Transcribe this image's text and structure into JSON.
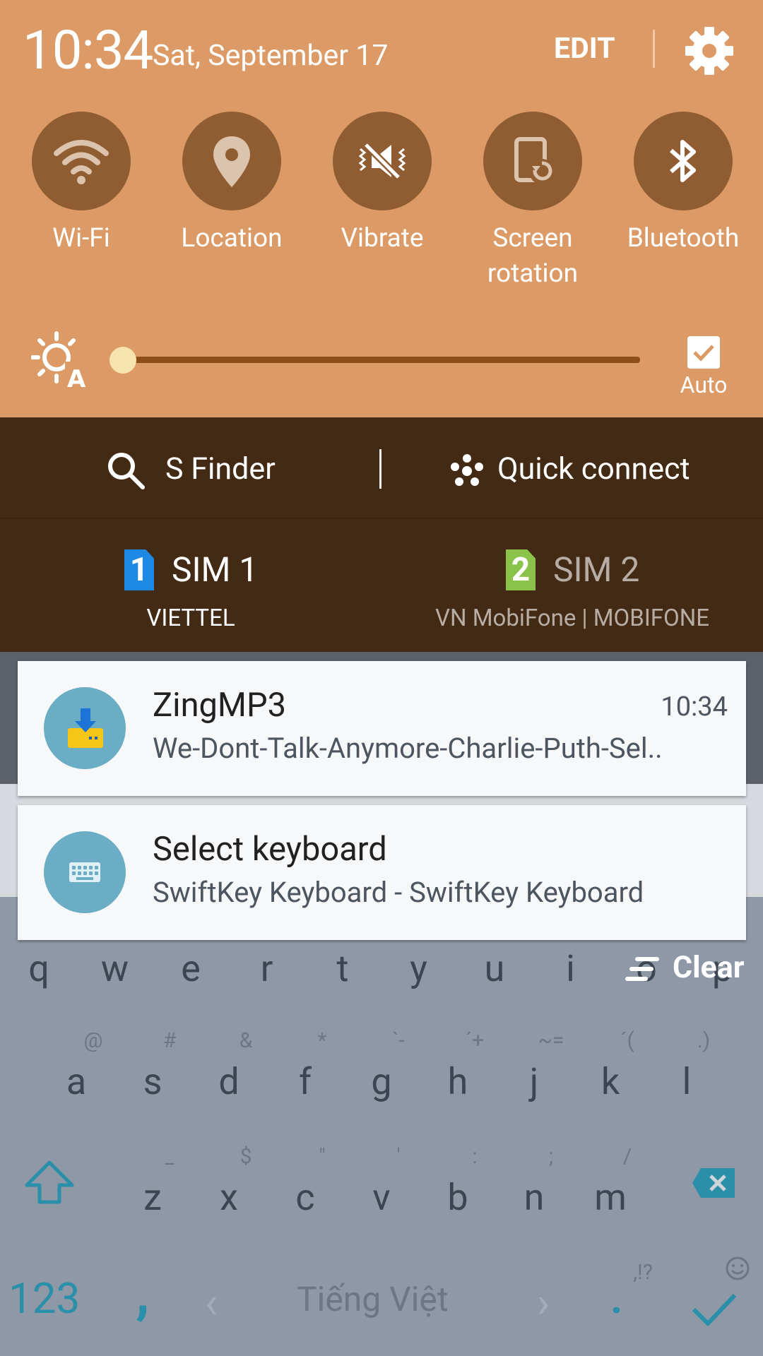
{
  "status": {
    "time": "10:34",
    "date": "Sat, September 17",
    "edit_label": "EDIT"
  },
  "quick_toggles": [
    {
      "label": "Wi-Fi",
      "icon": "wifi-icon"
    },
    {
      "label": "Location",
      "icon": "location-pin-icon"
    },
    {
      "label": "Vibrate",
      "icon": "vibrate-icon"
    },
    {
      "label": "Screen",
      "label2": "rotation",
      "icon": "screen-rotation-icon"
    },
    {
      "label": "Bluetooth",
      "icon": "bluetooth-icon"
    }
  ],
  "brightness": {
    "level": 0.0,
    "auto_label": "Auto",
    "auto_checked": true
  },
  "finder_bar": {
    "s_finder": "S Finder",
    "quick_connect": "Quick connect"
  },
  "sims": [
    {
      "badge": "1",
      "name": "SIM 1",
      "operator": "VIETTEL",
      "badge_color": "#1e88e5",
      "active": true
    },
    {
      "badge": "2",
      "name": "SIM 2",
      "operator": "VN MobiFone | MOBIFONE",
      "badge_color": "#8bc34a",
      "active": false
    }
  ],
  "notifications": [
    {
      "app": "ZingMP3",
      "time": "10:34",
      "text": "We-Dont-Talk-Anymore-Charlie-Puth-Sel..",
      "icon": "download-icon"
    },
    {
      "app": "Select keyboard",
      "text": "SwiftKey Keyboard - SwiftKey Keyboard",
      "icon": "keyboard-icon"
    }
  ],
  "clear_label": "Clear",
  "keyboard": {
    "row1": [
      "q",
      "w",
      "e",
      "r",
      "t",
      "y",
      "u",
      "i",
      "o",
      "p"
    ],
    "row2": [
      "a",
      "s",
      "d",
      "f",
      "g",
      "h",
      "j",
      "k",
      "l"
    ],
    "row2_hints": [
      "@",
      "#",
      "&",
      "*",
      "`-",
      "´+",
      "~=",
      "´(",
      ".)"
    ],
    "row3": [
      "z",
      "x",
      "c",
      "v",
      "b",
      "n",
      "m"
    ],
    "row3_hints": [
      "_",
      "$",
      "\"",
      "'",
      ":",
      ";",
      "/"
    ],
    "num_label": "123",
    "comma": ",",
    "language": "Tiếng Việt",
    "period": ".",
    "period_hint": ",!?"
  },
  "colors": {
    "header": "#dc9b66",
    "finder_bg": "#432a14",
    "tile": "#8f5d31",
    "accent_kbd": "#2a8fa8"
  }
}
